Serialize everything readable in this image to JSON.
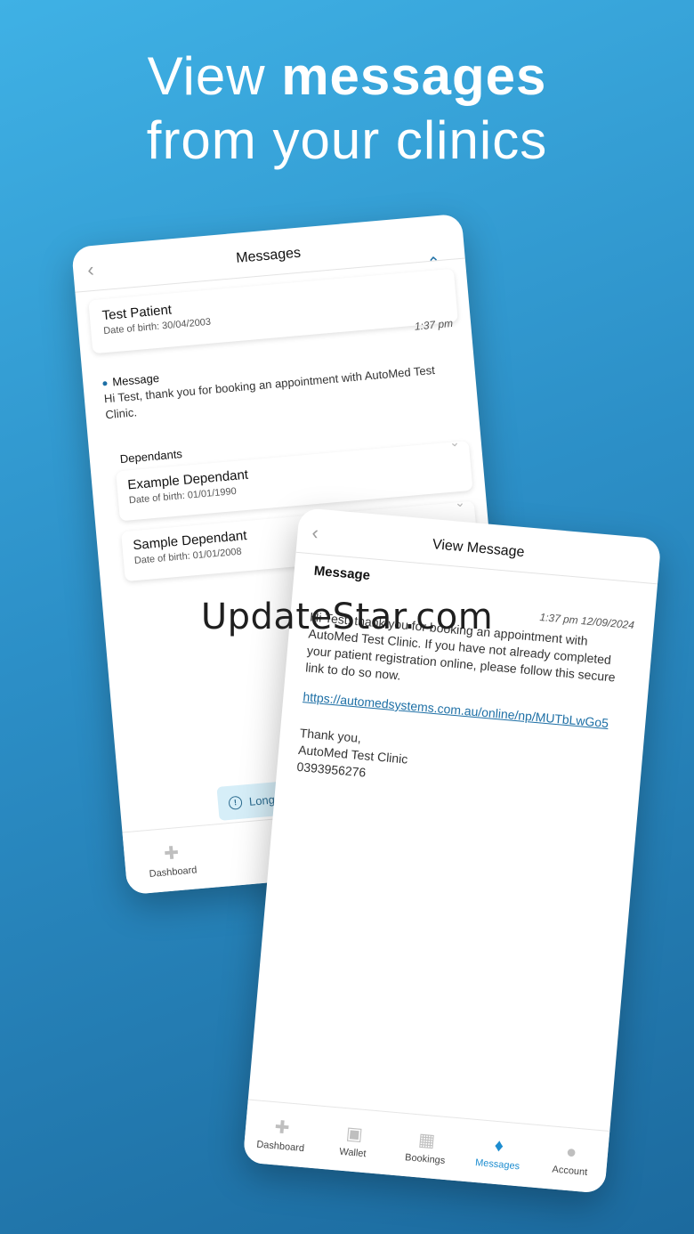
{
  "headline": {
    "line1_light": "View ",
    "line1_bold": "messages",
    "line2": "from your clinics"
  },
  "back_phone": {
    "title": "Messages",
    "patient": {
      "name": "Test Patient",
      "dob": "Date of birth: 30/04/2003"
    },
    "message": {
      "time": "1:37 pm",
      "label": "Message",
      "text": "Hi Test, thank you for booking an appointment with AutoMed Test Clinic."
    },
    "dependants_heading": "Dependants",
    "dependants": [
      {
        "name": "Example Dependant",
        "dob": "Date of birth: 01/01/1990"
      },
      {
        "name": "Sample Dependant",
        "dob": "Date of birth: 01/01/2008"
      }
    ],
    "info_text": "Long press a",
    "nav": [
      {
        "label": "Dashboard"
      }
    ]
  },
  "front_phone": {
    "title": "View Message",
    "label": "Message",
    "time": "1:37 pm 12/09/2024",
    "body": "Hi Test, thank you for booking an appointment with AutoMed Test Clinic. If you have not already completed your patient registration online, please follow this secure link to do so now.",
    "link": "https://automedsystems.com.au/online/np/MUTbLwGo5",
    "sign1": "Thank you,",
    "sign2": "AutoMed Test Clinic",
    "sign3": "0393956276",
    "nav": [
      {
        "label": "Dashboard",
        "icon": "dashboard-icon"
      },
      {
        "label": "Wallet",
        "icon": "wallet-icon"
      },
      {
        "label": "Bookings",
        "icon": "calendar-icon"
      },
      {
        "label": "Messages",
        "icon": "bell-icon"
      },
      {
        "label": "Account",
        "icon": "person-icon"
      }
    ]
  },
  "watermark": "UpdateStar.com",
  "colors": {
    "accent": "#1d8dd0",
    "background_top": "#3fb1e5",
    "background_bottom": "#1c6a9e"
  }
}
